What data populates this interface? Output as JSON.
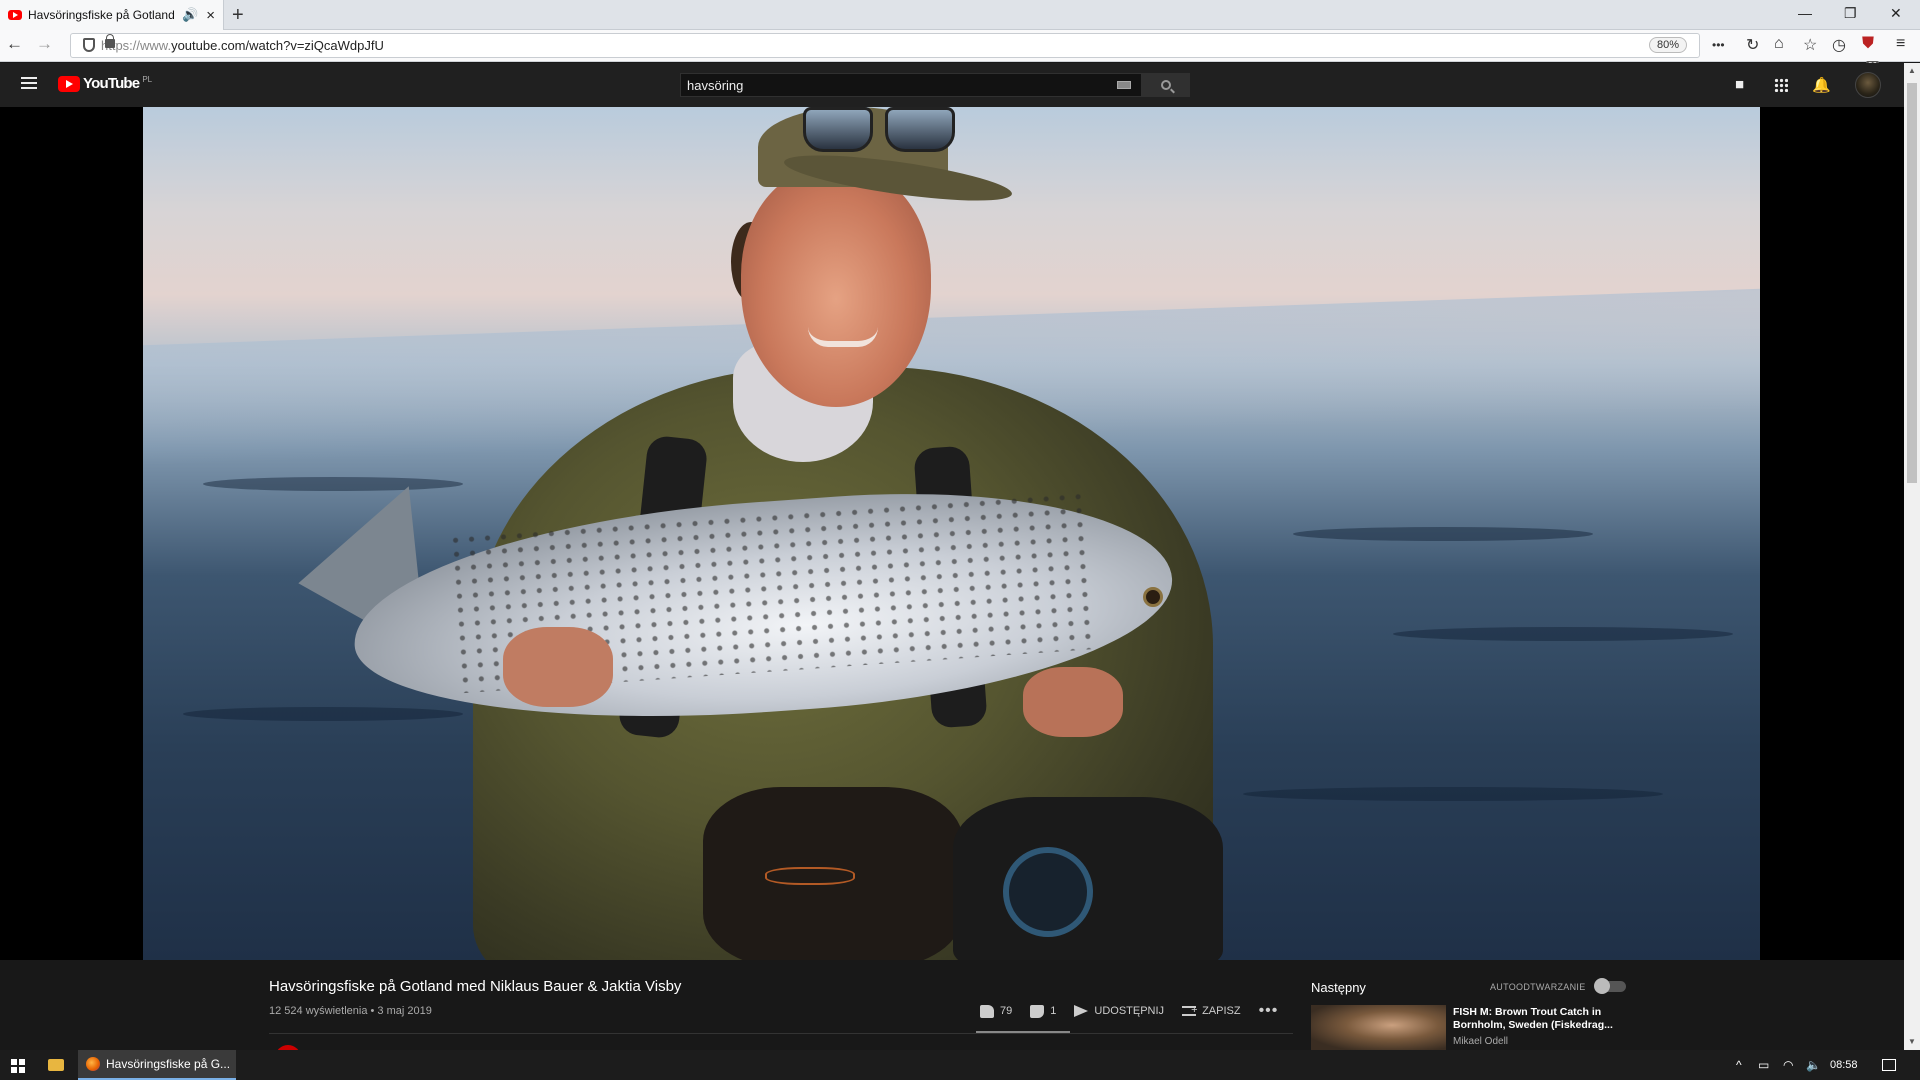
{
  "browser": {
    "tab_title": "Havsöringsfiske på Gotland",
    "new_tab": "+",
    "window_controls": [
      "—",
      "❐",
      "✕"
    ],
    "url_prefix": "https://www.",
    "url_rest": "youtube.com/watch?v=ziQcaWdpJfU",
    "zoom": "80%",
    "more": "•••",
    "addon_badge": "36"
  },
  "youtube": {
    "logo_text": "YouTube",
    "country": "PL",
    "search_query": "havsöring"
  },
  "video": {
    "title": "Havsöringsfiske på Gotland med Niklaus Bauer & Jaktia Visby",
    "meta": "12 524 wyświetlenia • 3 maj 2019",
    "likes": "79",
    "dislikes": "1",
    "share_label": "UDOSTĘPNIJ",
    "save_label": "ZAPISZ",
    "more": "•••"
  },
  "next": {
    "label": "Następny",
    "autoplay_label": "AUTOODTWARZANIE",
    "autoplay_on": false,
    "title": "FISH M: Brown Trout Catch in Bornholm, Sweden (Fiskedrag...",
    "channel": "Mikael Odell"
  },
  "taskbar": {
    "task_title": "Havsöringsfiske på G...",
    "clock": "08:58"
  },
  "colors": {
    "youtube_red": "#ff0000",
    "masthead": "#202020",
    "page_bg": "#181818"
  }
}
